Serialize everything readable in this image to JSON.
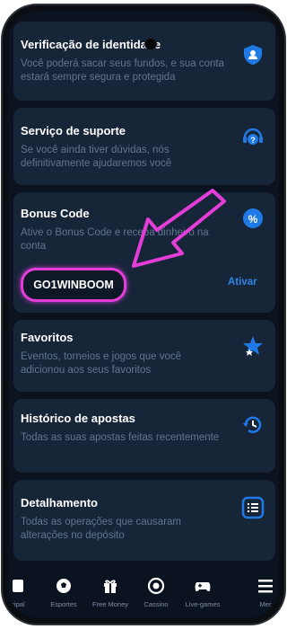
{
  "cards": [
    {
      "title": "Verificação de identidade",
      "desc": "Você poderá sacar seus fundos, e sua conta estará sempre segura e protegida",
      "icon": "shield-user-icon"
    },
    {
      "title": "Serviço de suporte",
      "desc": "Se você ainda tiver dúvidas, nós definitivamente ajudaremos você",
      "icon": "support-question-icon"
    },
    {
      "title": "Bonus Code",
      "desc": "Ative o Bonus Code e receba dinheiro na conta",
      "icon": "percent-badge-icon",
      "code": "GO1WINBOOM",
      "action": "Ativar"
    },
    {
      "title": "Favoritos",
      "desc": "Eventos, torneios e jogos que você adicionou aos seus favoritos",
      "icon": "star-icon"
    },
    {
      "title": "Histórico de apostas",
      "desc": "Todas as suas apostas feitas recentemente",
      "icon": "history-clock-icon"
    },
    {
      "title": "Detalhamento",
      "desc": "Todas as operações que causaram alterações no depósito",
      "icon": "list-icon"
    }
  ],
  "tabs": [
    {
      "label": "cipal",
      "icon": "home-icon"
    },
    {
      "label": "Esportes",
      "icon": "soccer-ball-icon"
    },
    {
      "label": "Free Money",
      "icon": "gift-icon"
    },
    {
      "label": "Cassino",
      "icon": "casino-chip-icon"
    },
    {
      "label": "Live-games",
      "icon": "gamepad-icon"
    },
    {
      "label": "Mer",
      "icon": "menu-icon"
    }
  ],
  "colors": {
    "background": "#0b1320",
    "card": "#172538",
    "accent": "#2f86e6",
    "highlight": "#e43dd8"
  }
}
